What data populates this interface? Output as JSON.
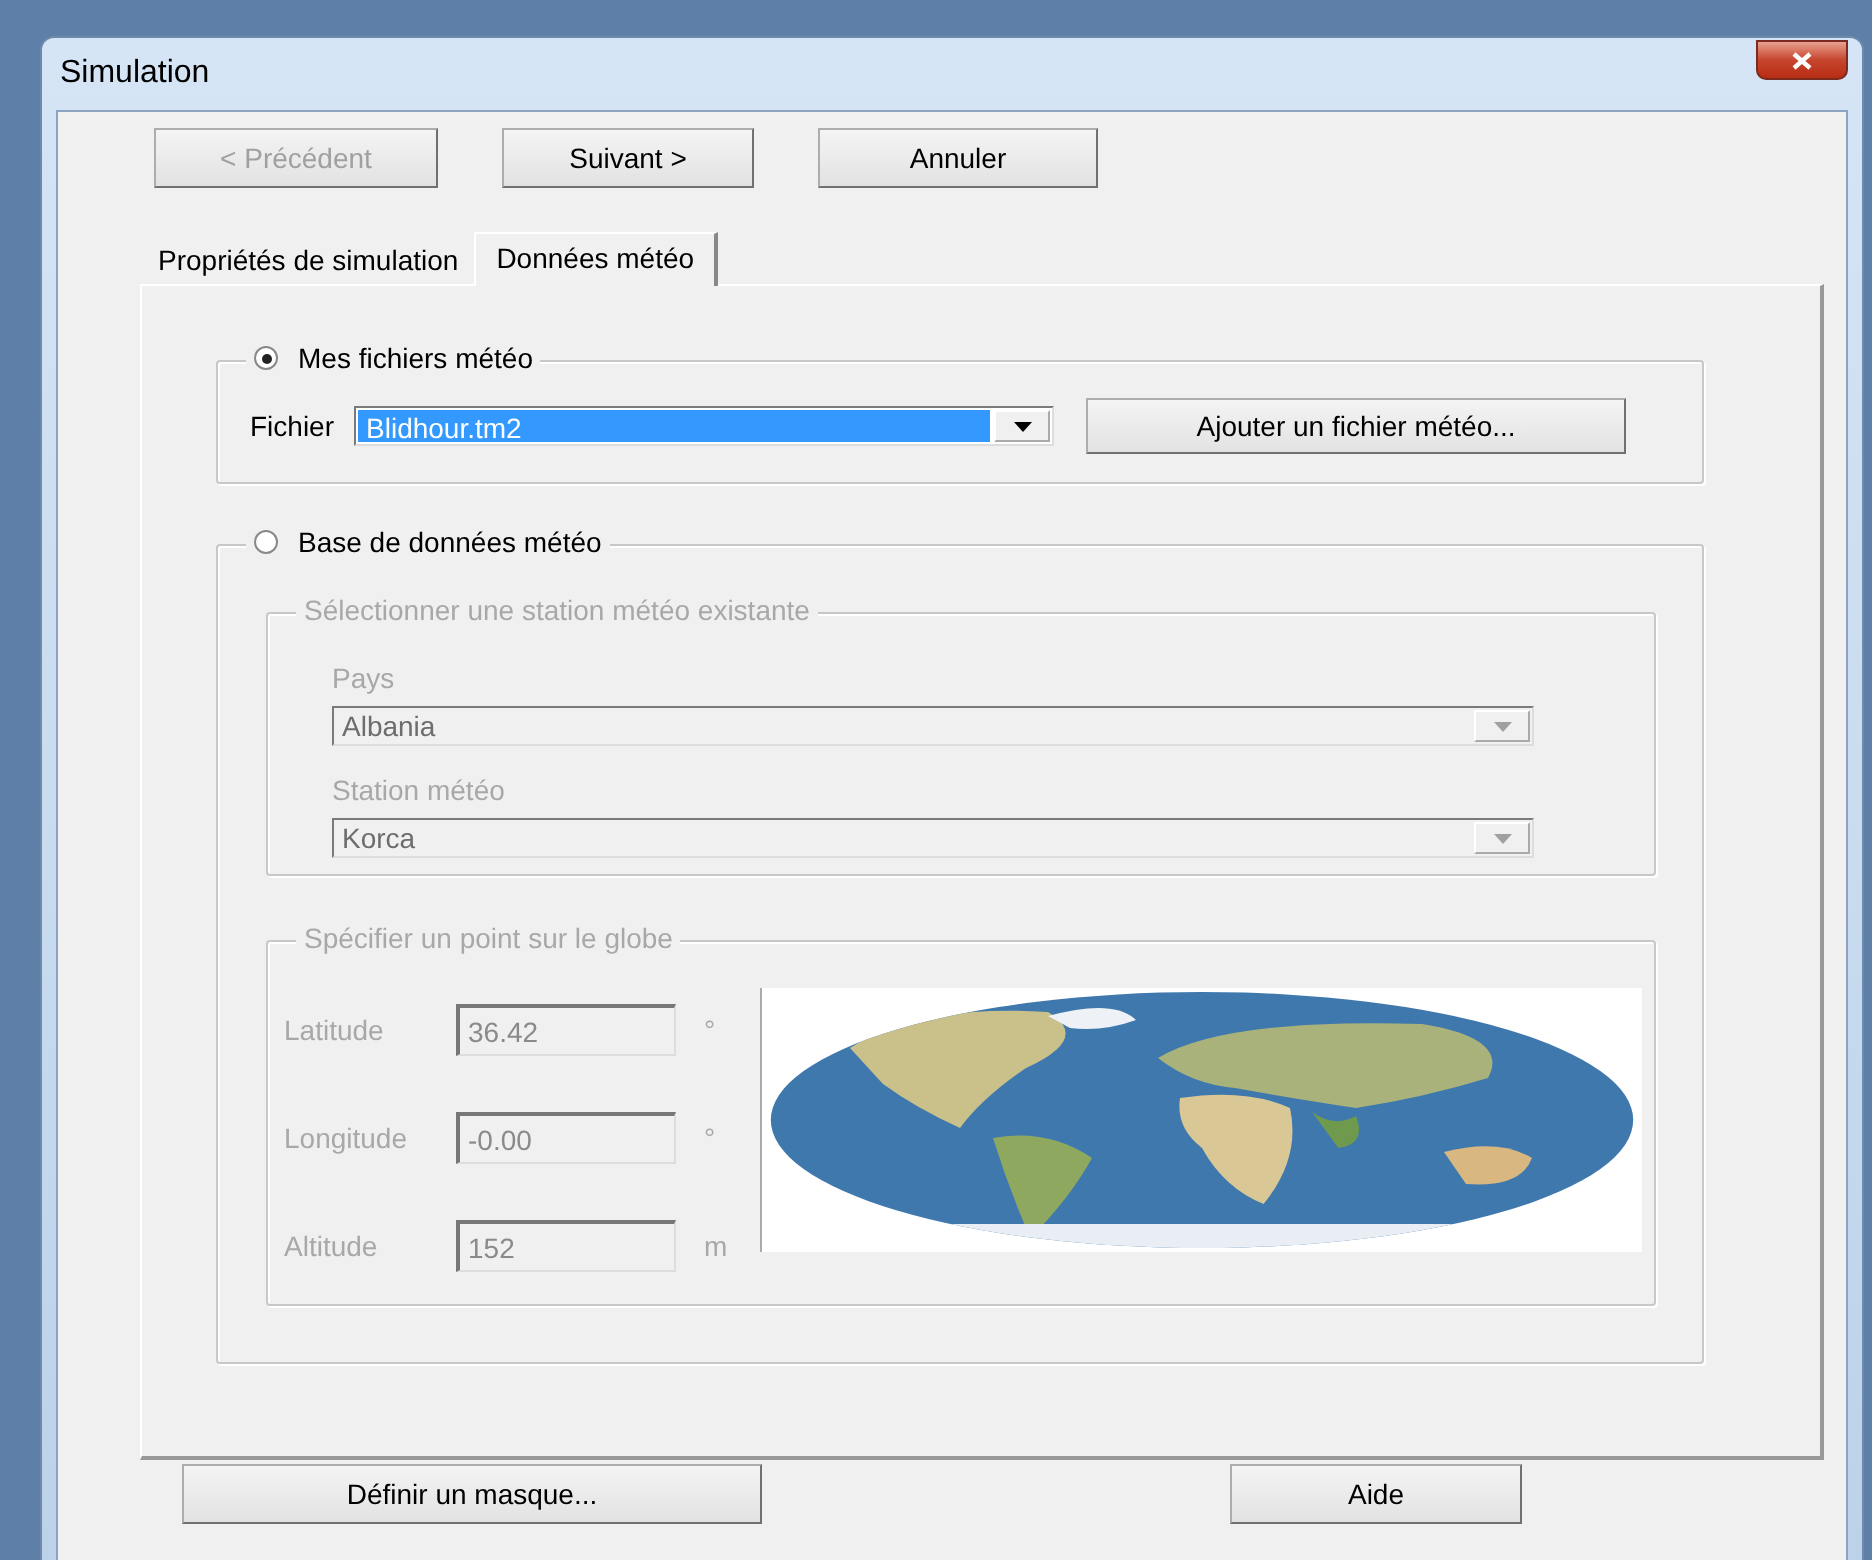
{
  "window": {
    "title": "Simulation"
  },
  "nav_buttons": [
    {
      "label": "< Précédent",
      "disabled": true
    },
    {
      "label": "Suivant >",
      "disabled": false
    },
    {
      "label": "Annuler",
      "disabled": false
    }
  ],
  "tabs": [
    {
      "label": "Propriétés de simulation",
      "selected": false
    },
    {
      "label": "Données météo",
      "selected": true
    }
  ],
  "sources": [
    {
      "label": "Mes fichiers météo",
      "selected": true
    },
    {
      "label": "Base de données météo",
      "selected": false
    }
  ],
  "file": {
    "label": "Fichier",
    "value": "Blidhour.tm2",
    "button": "Ajouter un fichier météo..."
  },
  "station_group": {
    "title": "Sélectionner une station météo existante",
    "country_label": "Pays",
    "country": "Albania",
    "station_label": "Station météo",
    "station": "Korca"
  },
  "point_group": {
    "title": "Spécifier un point sur le globe",
    "fields": [
      {
        "label": "Latitude",
        "value": "36.42",
        "unit": "°"
      },
      {
        "label": "Longitude",
        "value": "-0.00",
        "unit": "°"
      },
      {
        "label": "Altitude",
        "value": "152",
        "unit": "m"
      }
    ]
  },
  "footer_buttons": [
    "Définir un masque...",
    "Aide"
  ]
}
